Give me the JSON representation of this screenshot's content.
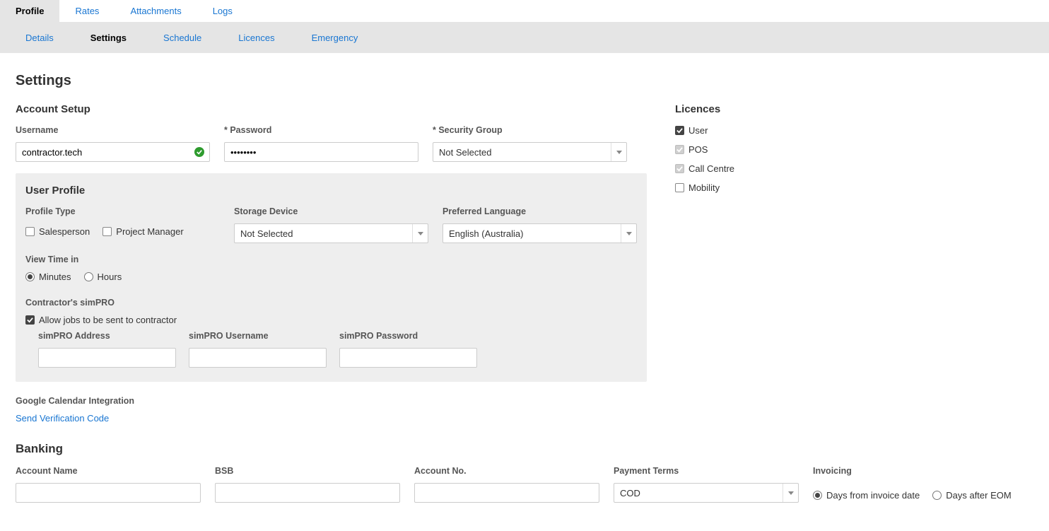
{
  "tabs_primary": [
    "Profile",
    "Rates",
    "Attachments",
    "Logs"
  ],
  "tabs_primary_active": 0,
  "tabs_secondary": [
    "Details",
    "Settings",
    "Schedule",
    "Licences",
    "Emergency"
  ],
  "tabs_secondary_active": 1,
  "page_title": "Settings",
  "account_setup": {
    "title": "Account Setup",
    "username_label": "Username",
    "username_value": "contractor.tech",
    "password_label": "* Password",
    "password_value": "••••••••",
    "security_group_label": "* Security Group",
    "security_group_value": "Not Selected"
  },
  "user_profile": {
    "title": "User Profile",
    "profile_type_label": "Profile Type",
    "salesperson_label": "Salesperson",
    "project_manager_label": "Project Manager",
    "storage_device_label": "Storage Device",
    "storage_device_value": "Not Selected",
    "preferred_language_label": "Preferred Language",
    "preferred_language_value": "English (Australia)",
    "view_time_label": "View Time in",
    "minutes_label": "Minutes",
    "hours_label": "Hours",
    "contractor_simpro_label": "Contractor's simPRO",
    "allow_jobs_label": "Allow jobs to be sent to contractor",
    "simpro_address_label": "simPRO Address",
    "simpro_username_label": "simPRO Username",
    "simpro_password_label": "simPRO Password"
  },
  "google": {
    "title": "Google Calendar Integration",
    "send_link": "Send Verification Code"
  },
  "licences": {
    "title": "Licences",
    "items": [
      {
        "label": "User",
        "checked": true,
        "disabled": false
      },
      {
        "label": "POS",
        "checked": true,
        "disabled": true
      },
      {
        "label": "Call Centre",
        "checked": true,
        "disabled": true
      },
      {
        "label": "Mobility",
        "checked": false,
        "disabled": false
      }
    ]
  },
  "banking": {
    "title": "Banking",
    "account_name_label": "Account Name",
    "bsb_label": "BSB",
    "account_no_label": "Account No.",
    "payment_terms_label": "Payment Terms",
    "payment_terms_value": "COD",
    "invoicing_label": "Invoicing",
    "days_from_invoice_label": "Days from invoice date",
    "days_after_eom_label": "Days after EOM"
  }
}
